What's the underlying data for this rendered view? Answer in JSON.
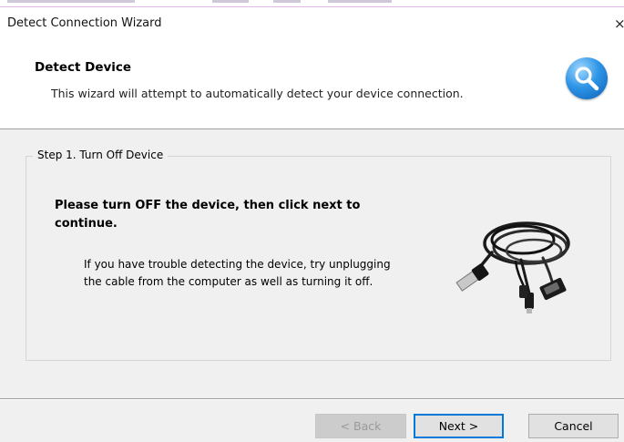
{
  "window": {
    "title": "Detect Connection Wizard",
    "close_glyph": "×"
  },
  "header": {
    "title": "Detect Device",
    "subtitle": "This wizard will attempt to automatically detect your device connection.",
    "icon": "search-magnifier-icon"
  },
  "step": {
    "legend": "Step 1. Turn Off Device",
    "instruction": "Please turn OFF the device, then click next to continue.",
    "hint": "If you have trouble detecting the device, try unplugging the cable from the computer as well as turning it off.",
    "image": "usb-serial-cable-image"
  },
  "buttons": {
    "back": "< Back",
    "next": "Next >",
    "cancel": "Cancel"
  },
  "colors": {
    "accent": "#0078d7",
    "dialog_bg": "#f0f0f0",
    "header_bg": "#ffffff",
    "disabled_text": "#9a9a9a"
  }
}
